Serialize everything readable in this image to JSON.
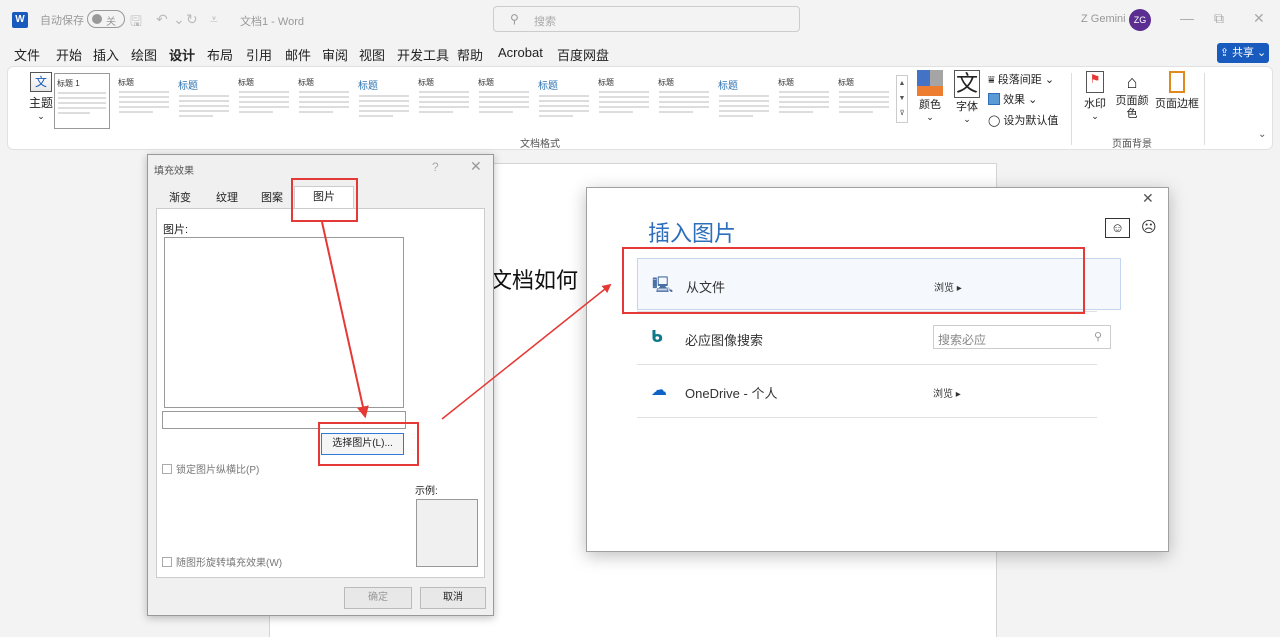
{
  "titlebar": {
    "autosave_label": "自动保存",
    "autosave_state": "关",
    "doc_title": "文档1 - Word",
    "search_placeholder": "搜索",
    "user_name": "Z Gemini",
    "avatar_initials": "ZG",
    "word_icon": "W"
  },
  "menu": {
    "tabs": [
      "文件",
      "开始",
      "插入",
      "绘图",
      "设计",
      "布局",
      "引用",
      "邮件",
      "审阅",
      "视图",
      "开发工具",
      "帮助",
      "Acrobat",
      "百度网盘"
    ],
    "active_index": 4,
    "share_label": "共享"
  },
  "ribbon": {
    "theme_label": "主题",
    "gallery_heading": "标题",
    "gallery_heading_1": "标题 1",
    "gallery_group_label": "文档格式",
    "colors_label": "颜色",
    "fonts_label": "字体",
    "fonts_glyph": "文",
    "paragraph_spacing_label": "段落间距",
    "effects_label": "效果",
    "set_default_label": "设为默认值",
    "watermark_label": "水印",
    "page_color_label": "页面颜色",
    "page_borders_label": "页面边框",
    "page_background_group_label": "页面背景",
    "accent_colors": [
      "#4472c4",
      "#ed7d31",
      "#a5a5a5",
      "#ffc000"
    ]
  },
  "document": {
    "visible_text": "文档如何"
  },
  "fill_dialog": {
    "title": "填充效果",
    "help": "?",
    "tabs": [
      "渐变",
      "纹理",
      "图案",
      "图片"
    ],
    "active_tab_index": 3,
    "picture_label": "图片:",
    "choose_button": "选择图片(L)...",
    "lock_aspect_label": "锁定图片纵横比(P)",
    "rotate_label": "随图形旋转填充效果(W)",
    "sample_label": "示例:",
    "ok_button": "确定",
    "cancel_button": "取消"
  },
  "insert_panel": {
    "title": "插入图片",
    "rows": [
      {
        "name": "从文件",
        "action": "浏览 ▸",
        "icon": "computer-icon"
      },
      {
        "name": "必应图像搜索",
        "search_placeholder": "搜索必应",
        "icon": "bing-icon"
      },
      {
        "name": "OneDrive - 个人",
        "action": "浏览 ▸",
        "icon": "onedrive-icon"
      }
    ]
  },
  "colors": {
    "brand_blue": "#185abd",
    "annotation_red": "#e53935",
    "title_blue": "#2e6fbb"
  }
}
